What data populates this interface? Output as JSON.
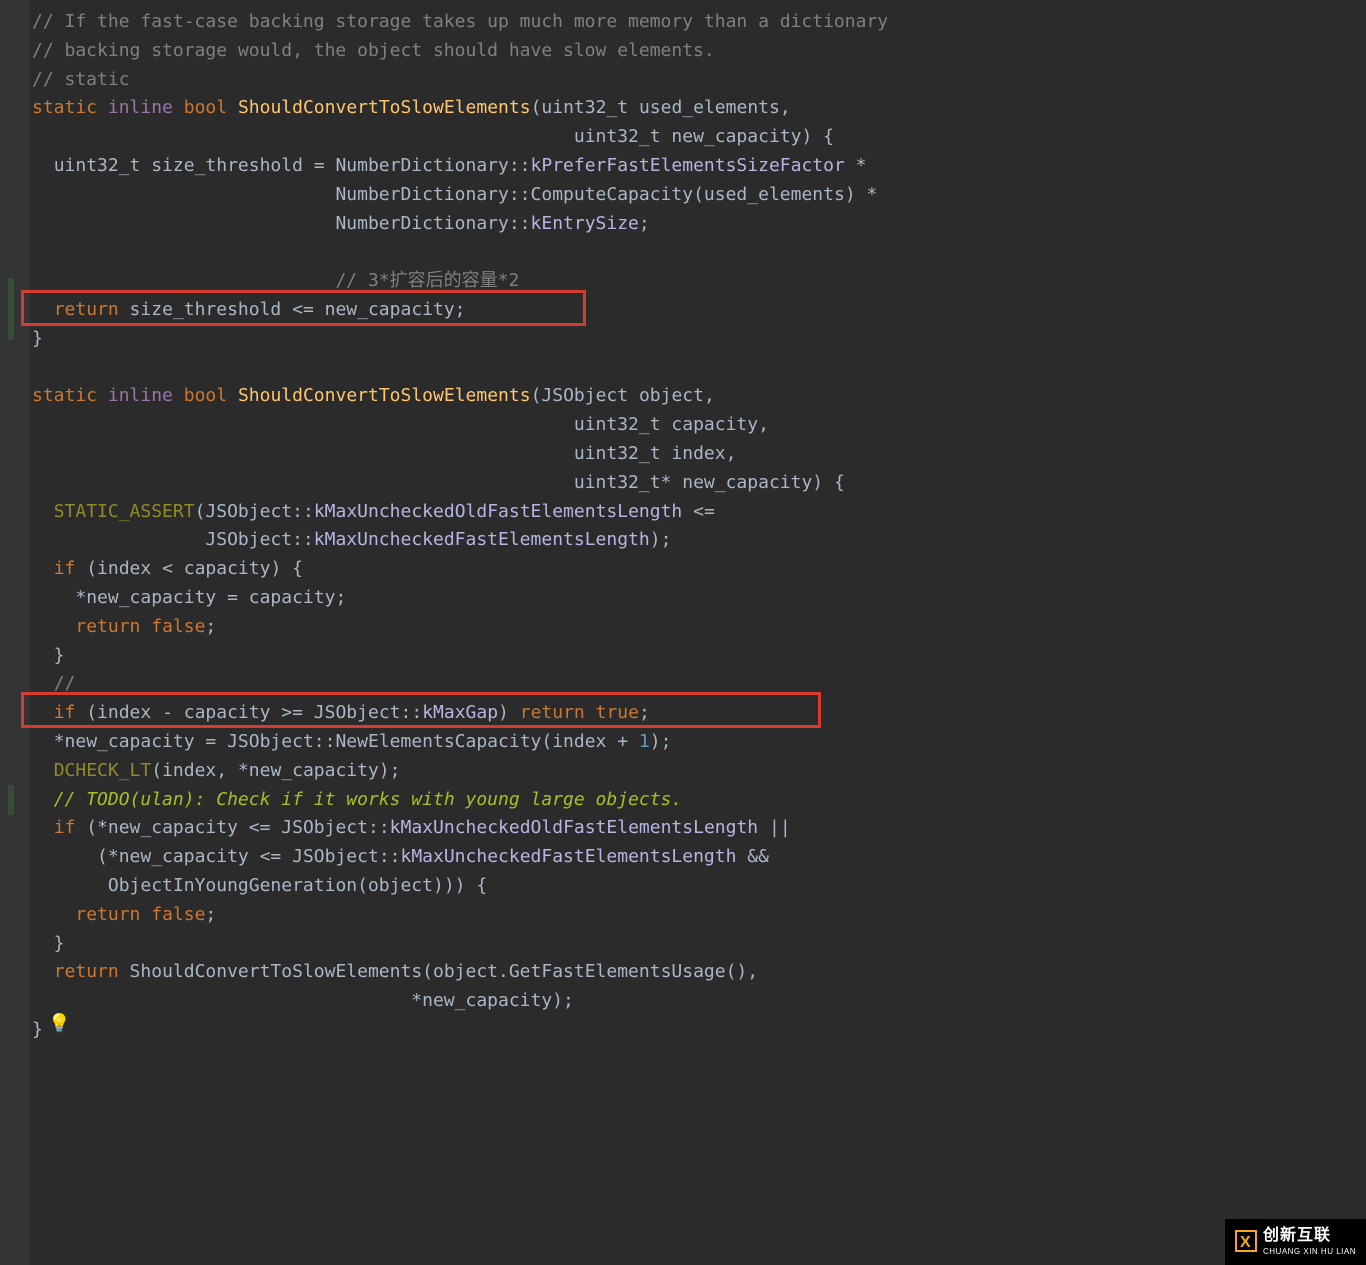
{
  "code": {
    "c1": "// If the fast-case backing storage takes up much more memory than a dictionary",
    "c2": "// backing storage would, the object should have slow elements.",
    "c3": "// static",
    "kw_static1": "static",
    "kw_inline1": "inline",
    "kw_bool1": "bool",
    "fn1": "ShouldConvertToSlowElements",
    "p1_t1": "uint32_t",
    "p1_n1": "used_elements",
    "p1_t2": "uint32_t",
    "p1_n2": "new_capacity",
    "var_decl": "uint32_t size_threshold = ",
    "rhs1a": "NumberDictionary",
    "rhs1b": "kPreferFastElementsSizeFactor",
    "rhs2a": "NumberDictionary",
    "rhs2b": "ComputeCapacity",
    "rhs2c": "used_elements",
    "rhs3a": "NumberDictionary",
    "rhs3b": "kEntrySize",
    "c4": "// 3*扩容后的容量*2",
    "kw_return1": "return",
    "ret1": " size_threshold <= new_capacity;",
    "kw_static2": "static",
    "kw_inline2": "inline",
    "kw_bool2": "bool",
    "fn2": "ShouldConvertToSlowElements",
    "p2_t1": "JSObject",
    "p2_n1": "object",
    "p2_t2": "uint32_t",
    "p2_n2": "capacity",
    "p2_t3": "uint32_t",
    "p2_n3": "index",
    "p2_t4": "uint32_t*",
    "p2_n4": "new_capacity",
    "assert": "STATIC_ASSERT",
    "assert_a1": "JSObject",
    "assert_a2": "kMaxUncheckedOldFastElementsLength",
    "assert_b1": "JSObject",
    "assert_b2": "kMaxUncheckedFastElementsLength",
    "kw_if1": "if",
    "cond1": " (index < capacity) {",
    "assign1": "  *new_capacity = capacity;",
    "kw_return2": "return",
    "kw_false1": "false",
    "c5": "//",
    "kw_if2": "if",
    "cond2a": " (index - capacity >= ",
    "cond2b": "JSObject",
    "cond2c": "kMaxGap",
    "kw_return3": "return",
    "kw_true1": "true",
    "assign2a": "*new_capacity = ",
    "assign2b": "JSObject",
    "assign2c": "NewElementsCapacity",
    "assign2d": "index + ",
    "num1": "1",
    "dcheck": "DCHECK_LT",
    "dcheck_args": "(index, *new_capacity);",
    "todo": "// TODO(ulan): Check if it works with young large objects.",
    "kw_if3": "if",
    "cond3a": " (*new_capacity <= ",
    "cond3b": "JSObject",
    "cond3c": "kMaxUncheckedOldFastElementsLength",
    "cond3d": " ||",
    "cond4a": "    (*new_capacity <= ",
    "cond4b": "JSObject",
    "cond4c": "kMaxUncheckedFastElementsLength",
    "cond4d": " &&",
    "cond5": "     ObjectInYoungGeneration(object))) {",
    "kw_return4": "return",
    "kw_false2": "false",
    "kw_return5": "return",
    "ret5a": " ShouldConvertToSlowElements(object.GetFastElementsUsage(),",
    "ret5b": "                                   *new_capacity);"
  },
  "watermark": {
    "cn": "创新互联",
    "en": "CHUANG XIN HU LIAN"
  }
}
